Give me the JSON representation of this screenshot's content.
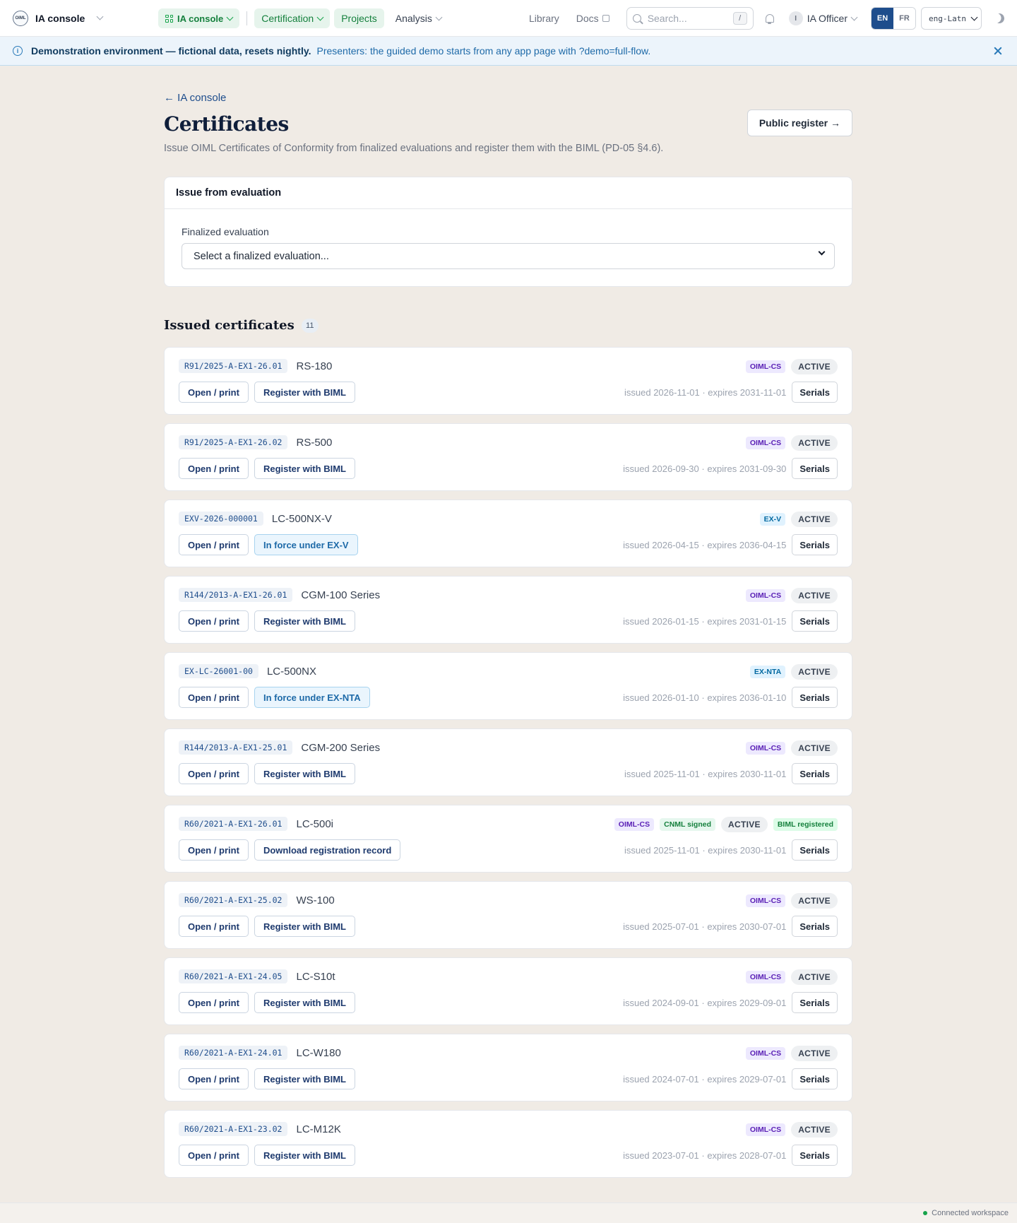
{
  "nav": {
    "brand": "IA console",
    "logo_text": "OIML",
    "console_pill": "IA console",
    "certification": "Certification",
    "projects": "Projects",
    "analysis": "Analysis",
    "library": "Library",
    "docs": "Docs",
    "search_placeholder": "Search...",
    "search_shortcut": "/",
    "user_initial": "I",
    "user_name": "IA Officer",
    "lang_en": "EN",
    "lang_fr": "FR",
    "script": "eng-Latn"
  },
  "banner": {
    "strong": "Demonstration environment — fictional data, resets nightly.",
    "text": "Presenters: the guided demo starts from any app page with ?demo=full-flow."
  },
  "page": {
    "back": "← IA console",
    "title": "Certificates",
    "public_register": "Public register →",
    "subtitle": "Issue OIML Certificates of Conformity from finalized evaluations and register them with the BIML (PD-05 §4.6)."
  },
  "issue": {
    "header": "Issue from evaluation",
    "label": "Finalized evaluation",
    "placeholder": "Select a finalized evaluation..."
  },
  "issued": {
    "title": "Issued certificates",
    "count": "11",
    "open_label": "Open / print",
    "serials_label": "Serials",
    "items": [
      {
        "id": "R91/2025-A-EX1-26.01",
        "model": "RS-180",
        "scheme": "OIML-CS",
        "status": "ACTIVE",
        "action": "Register with BIML",
        "dates": "issued 2026-11-01 · expires 2031-11-01"
      },
      {
        "id": "R91/2025-A-EX1-26.02",
        "model": "RS-500",
        "scheme": "OIML-CS",
        "status": "ACTIVE",
        "action": "Register with BIML",
        "dates": "issued 2026-09-30 · expires 2031-09-30"
      },
      {
        "id": "EXV-2026-000001",
        "model": "LC-500NX-V",
        "scheme": "EX-V",
        "status": "ACTIVE",
        "action": "In force under EX-V",
        "dates": "issued 2026-04-15 · expires 2036-04-15"
      },
      {
        "id": "R144/2013-A-EX1-26.01",
        "model": "CGM-100 Series",
        "scheme": "OIML-CS",
        "status": "ACTIVE",
        "action": "Register with BIML",
        "dates": "issued 2026-01-15 · expires 2031-01-15"
      },
      {
        "id": "EX-LC-26001-00",
        "model": "LC-500NX",
        "scheme": "EX-NTA",
        "status": "ACTIVE",
        "action": "In force under EX-NTA",
        "dates": "issued 2026-01-10 · expires 2036-01-10"
      },
      {
        "id": "R144/2013-A-EX1-25.01",
        "model": "CGM-200 Series",
        "scheme": "OIML-CS",
        "status": "ACTIVE",
        "action": "Register with BIML",
        "dates": "issued 2025-11-01 · expires 2030-11-01"
      },
      {
        "id": "R60/2021-A-EX1-26.01",
        "model": "LC-500i",
        "scheme": "OIML-CS",
        "cnml": "CNML signed",
        "status": "ACTIVE",
        "biml": "BIML registered",
        "action": "Download registration record",
        "dates": "issued 2025-11-01 · expires 2030-11-01"
      },
      {
        "id": "R60/2021-A-EX1-25.02",
        "model": "WS-100",
        "scheme": "OIML-CS",
        "status": "ACTIVE",
        "action": "Register with BIML",
        "dates": "issued 2025-07-01 · expires 2030-07-01"
      },
      {
        "id": "R60/2021-A-EX1-24.05",
        "model": "LC-S10t",
        "scheme": "OIML-CS",
        "status": "ACTIVE",
        "action": "Register with BIML",
        "dates": "issued 2024-09-01 · expires 2029-09-01"
      },
      {
        "id": "R60/2021-A-EX1-24.01",
        "model": "LC-W180",
        "scheme": "OIML-CS",
        "status": "ACTIVE",
        "action": "Register with BIML",
        "dates": "issued 2024-07-01 · expires 2029-07-01"
      },
      {
        "id": "R60/2021-A-EX1-23.02",
        "model": "LC-M12K",
        "scheme": "OIML-CS",
        "status": "ACTIVE",
        "action": "Register with BIML",
        "dates": "issued 2023-07-01 · expires 2028-07-01"
      }
    ]
  },
  "footer": {
    "status": "Connected workspace"
  }
}
